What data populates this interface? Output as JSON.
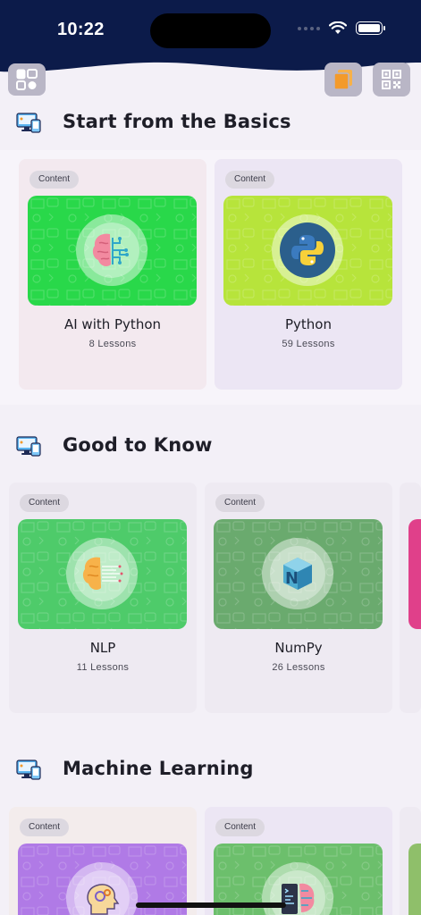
{
  "status_bar": {
    "time": "10:22"
  },
  "top_buttons": {
    "dashboard_icon": "dashboard-grid-icon",
    "library_icon": "library-books-icon",
    "qr_icon": "qr-code-icon"
  },
  "colors": {
    "header": "#0c1b4a",
    "background": "#f3f0f7",
    "accent_orange": "#f39a2a"
  },
  "sections": [
    {
      "title": "Start from the Basics",
      "cards": [
        {
          "badge": "Content",
          "name": "AI with Python",
          "lessons": "8 Lessons",
          "thumb_color": "#29d84a",
          "icon": "brain-circuit-icon"
        },
        {
          "badge": "Content",
          "name": "Python",
          "lessons": "59 Lessons",
          "thumb_color": "#b7e43b",
          "icon": "python-logo-icon"
        }
      ]
    },
    {
      "title": "Good to Know",
      "cards": [
        {
          "badge": "Content",
          "name": "NLP",
          "lessons": "11 Lessons",
          "thumb_color": "#4ecb6a",
          "icon": "nlp-brain-icon"
        },
        {
          "badge": "Content",
          "name": "NumPy",
          "lessons": "26 Lessons",
          "thumb_color": "#6aaa6e",
          "icon": "numpy-logo-icon"
        }
      ]
    },
    {
      "title": "Machine Learning",
      "cards": [
        {
          "badge": "Content",
          "thumb_color": "#b07ae6",
          "icon": "head-gears-icon"
        },
        {
          "badge": "Content",
          "thumb_color": "#6cbf6c",
          "icon": "code-brain-icon"
        }
      ]
    }
  ]
}
